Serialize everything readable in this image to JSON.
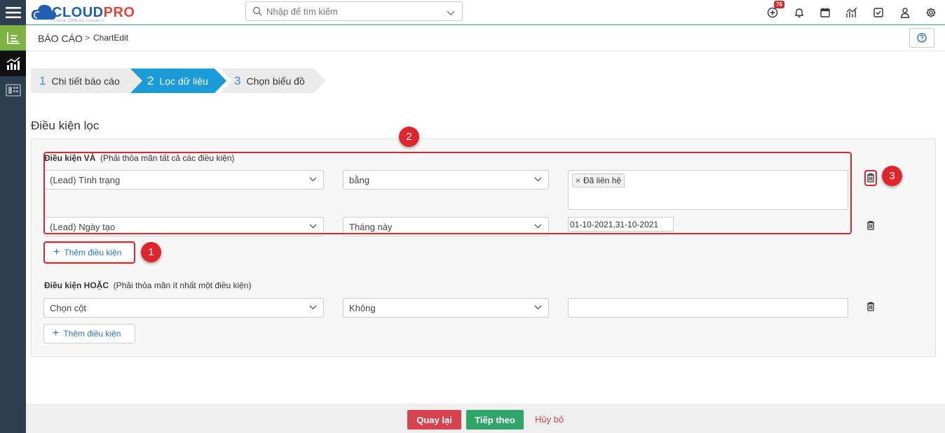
{
  "app": {
    "logo_main": "CLOUD",
    "logo_accent": "PRO",
    "logo_tagline": "Cloud CRM by Industry"
  },
  "search": {
    "placeholder": "Nhập để tìm kiếm"
  },
  "topbar": {
    "notification_count": "76"
  },
  "breadcrumb": {
    "main": "BÁO CÁO",
    "separator": ">",
    "sub": "ChartEdit"
  },
  "steps": [
    {
      "num": "1",
      "label": "Chi tiết báo cáo"
    },
    {
      "num": "2",
      "label": "Lọc dữ liệu"
    },
    {
      "num": "3",
      "label": "Chọn biểu đồ"
    }
  ],
  "section_title": "Điều kiện lọc",
  "and_group": {
    "label": "Điều kiện VÀ",
    "hint": "(Phải thỏa mãn tất cả các điều kiện)",
    "rows": [
      {
        "column": "(Lead) Tình trạng",
        "operator": "bằng",
        "tag": "Đã liên hệ"
      },
      {
        "column": "(Lead) Ngày tạo",
        "operator": "Tháng này",
        "value": "01-10-2021,31-10-2021"
      }
    ],
    "add_label": "Thêm điều kiện"
  },
  "or_group": {
    "label": "Điều kiện HOẶC",
    "hint": "(Phải thỏa mãn ít nhất một điều kiện)",
    "rows": [
      {
        "column": "Chọn cột",
        "operator": "Không",
        "value": ""
      }
    ],
    "add_label": "Thêm điều kiện"
  },
  "annotations": {
    "m1": "1",
    "m2": "2",
    "m3": "3"
  },
  "footer": {
    "back": "Quay lại",
    "next": "Tiếp theo",
    "cancel": "Hủy bỏ"
  },
  "colors": {
    "accent": "#1b9bd7",
    "annotation": "#e0252d",
    "back": "#d6434f",
    "next": "#2fa569"
  }
}
